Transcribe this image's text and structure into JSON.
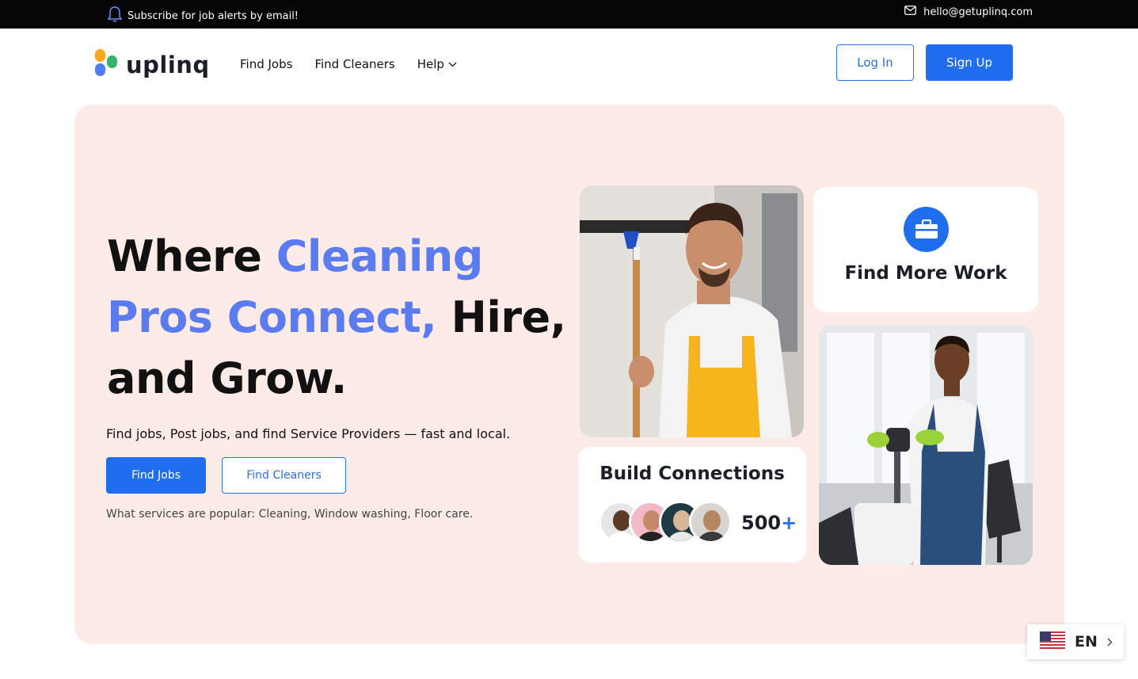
{
  "topbar": {
    "subscribe_text": "Subscribe for job alerts by email!",
    "email": "hello@getuplinq.com"
  },
  "brand": {
    "logo_text": "uplinq",
    "logo_colors": [
      "#f7a81b",
      "#33b36b",
      "#4d7cf5",
      "#2d9cdb"
    ]
  },
  "nav": {
    "links": [
      "Find Jobs",
      "Find Cleaners",
      "Help"
    ],
    "login": "Log In",
    "signup": "Sign Up"
  },
  "hero": {
    "headline_part1": "Where ",
    "headline_blue": "Cleaning Pros Connect,",
    "headline_part2": " Hire, and Grow.",
    "subtext": "Find jobs, Post jobs, and find Service Providers — fast and local.",
    "cta_primary": "Find Jobs",
    "cta_secondary": "Find Cleaners",
    "popular": "What services are popular: Cleaning, Window washing, Floor care."
  },
  "cards": {
    "find_work": "Find More Work",
    "build_connections": "Build Connections",
    "count_number": "500",
    "count_suffix": "+"
  },
  "language": {
    "code": "EN"
  },
  "colors": {
    "accent": "#1f6ef0",
    "headline_blue": "#5b7cf0",
    "hero_bg": "#fcebe7"
  }
}
